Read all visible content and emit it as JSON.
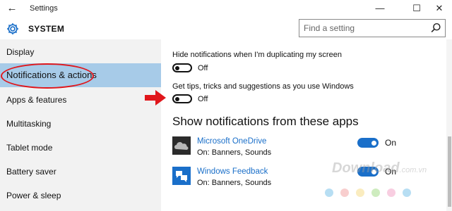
{
  "window": {
    "title": "Settings",
    "back_icon": "←",
    "minimize_icon": "—",
    "maximize_icon": "☐",
    "close_icon": "✕"
  },
  "header": {
    "title": "SYSTEM",
    "search_placeholder": "Find a setting"
  },
  "sidebar": {
    "items": [
      {
        "label": "Display"
      },
      {
        "label": "Notifications & actions",
        "selected": true
      },
      {
        "label": "Apps & features"
      },
      {
        "label": "Multitasking"
      },
      {
        "label": "Tablet mode"
      },
      {
        "label": "Battery saver"
      },
      {
        "label": "Power & sleep"
      }
    ]
  },
  "main": {
    "settings": [
      {
        "label": "Hide notifications when I'm duplicating my screen",
        "state": "Off"
      },
      {
        "label": "Get tips, tricks and suggestions as you use Windows",
        "state": "Off"
      }
    ],
    "apps_heading": "Show notifications from these apps",
    "apps": [
      {
        "name": "Microsoft OneDrive",
        "detail": "On: Banners, Sounds",
        "state": "On"
      },
      {
        "name": "Windows Feedback",
        "detail": "On: Banners, Sounds",
        "state": "On"
      }
    ]
  },
  "watermark": {
    "text": "Download",
    "ext": ".com.vn"
  },
  "colors": {
    "accent": "#1a6fc9",
    "sidebar_bg": "#f2f2f2",
    "selected_bg": "#a7cbe8",
    "annotation_red": "#e0161b"
  }
}
